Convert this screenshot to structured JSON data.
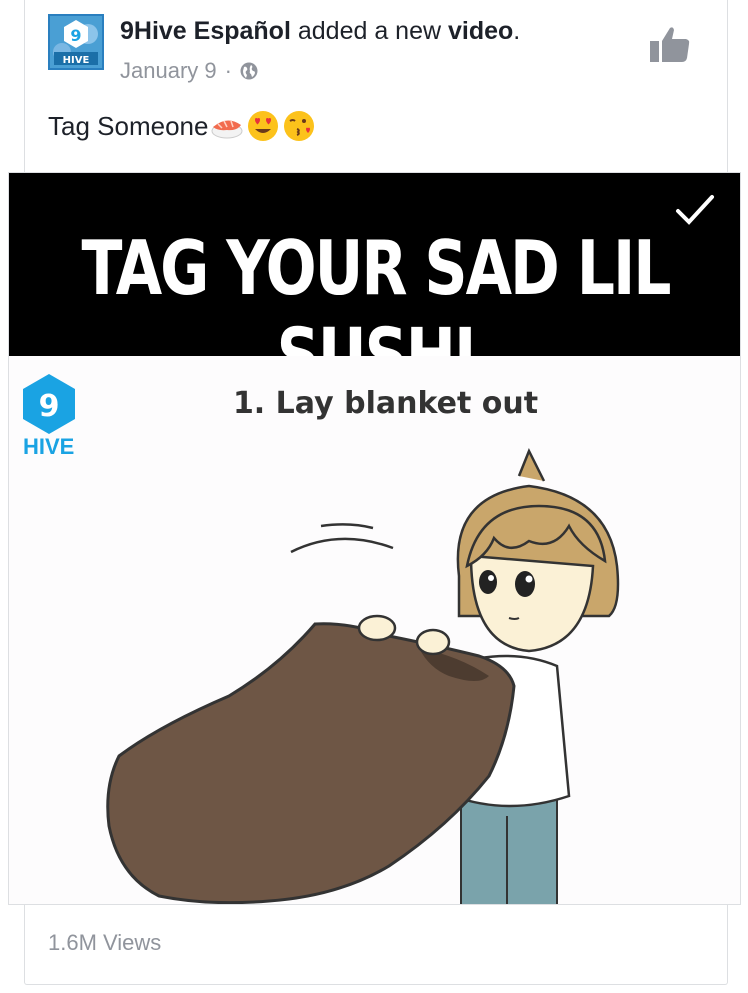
{
  "post": {
    "page_name": "9Hive Español",
    "action_mid": "added a new",
    "action_object": "video",
    "action_end": ".",
    "date": "January 9",
    "separator": "·",
    "text": "Tag Someone",
    "emojis": [
      "sushi-icon",
      "heart-eyes-icon",
      "kissing-face-icon"
    ],
    "avatar": {
      "number": "9",
      "label": "HIVE"
    }
  },
  "video": {
    "banner_title": "TAG YOUR SAD LIL SUSHI",
    "step_title": "1. Lay blanket out",
    "logo_number": "9",
    "logo_text": "HIVE"
  },
  "footer": {
    "views": "1.6M Views"
  },
  "colors": {
    "brand_blue": "#1aa3e3",
    "text_primary": "#1d2129",
    "text_secondary": "#90949c",
    "blanket": "#6e5645"
  }
}
